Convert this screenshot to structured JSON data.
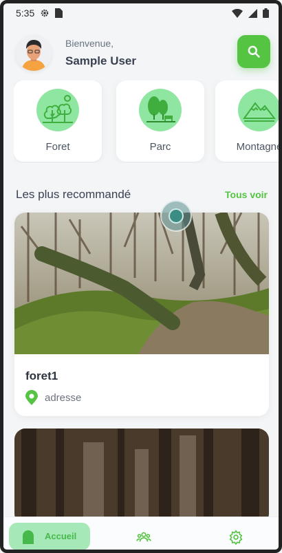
{
  "status": {
    "time": "5:35"
  },
  "header": {
    "greeting": "Bienvenue,",
    "user_name": "Sample User"
  },
  "categories": [
    {
      "label": "Foret",
      "icon": "forest-icon"
    },
    {
      "label": "Parc",
      "icon": "park-icon"
    },
    {
      "label": "Montagne",
      "icon": "mountain-icon"
    }
  ],
  "section": {
    "title": "Les plus recommandé",
    "see_all": "Tous voir"
  },
  "places": [
    {
      "title": "foret1",
      "address": "adresse"
    }
  ],
  "nav": {
    "home_label": "Accueil"
  },
  "colors": {
    "accent": "#55c443",
    "category_bg": "#8ee6a0",
    "home_tab_bg": "#a6e8b7"
  }
}
